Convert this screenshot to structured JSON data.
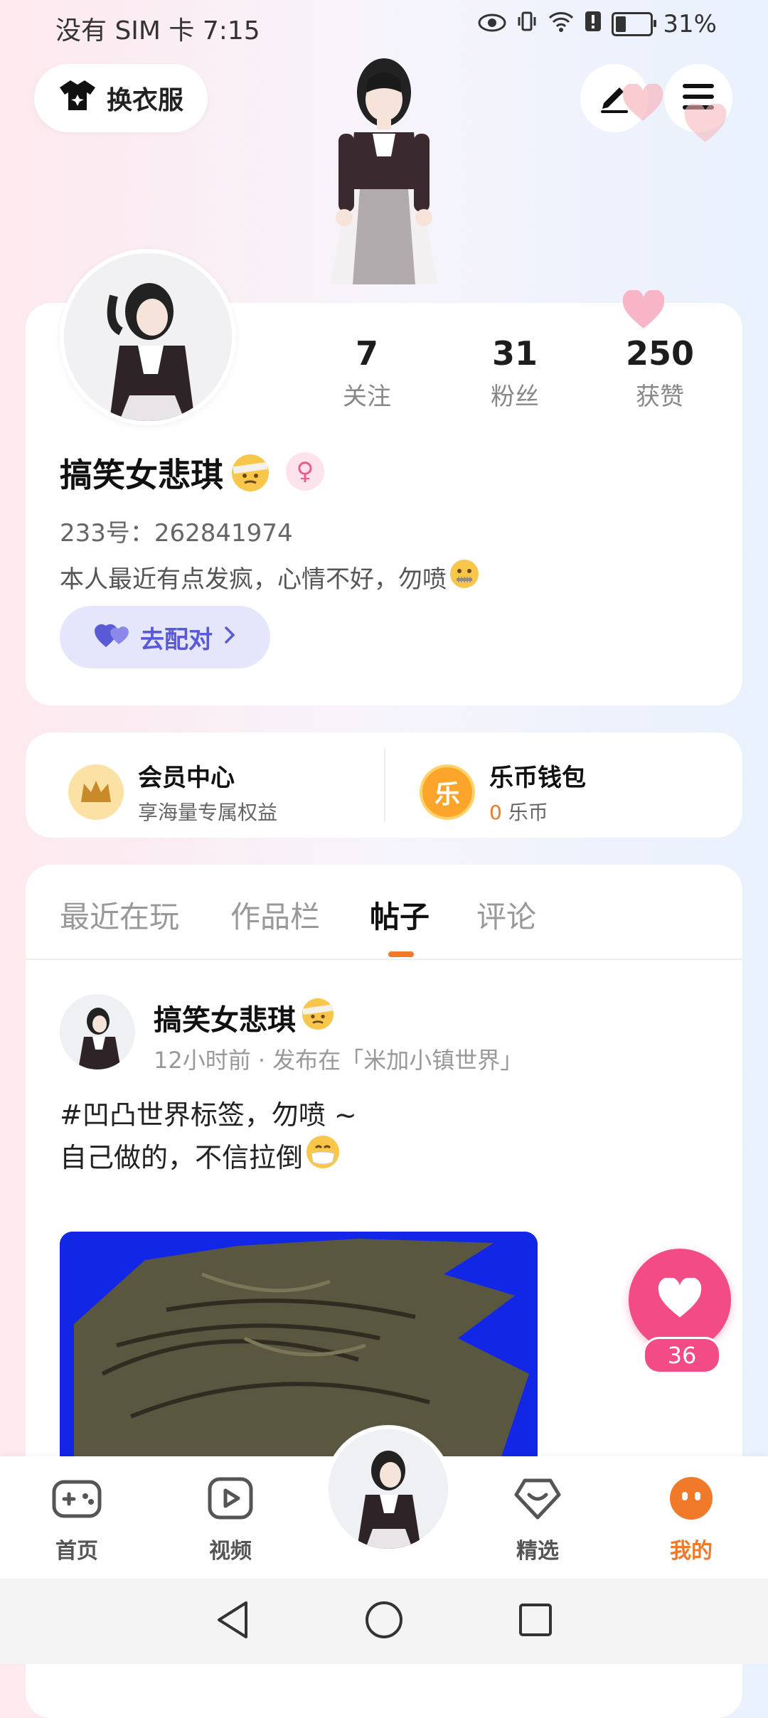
{
  "status_bar": {
    "carrier_time": "没有 SIM 卡 7:15",
    "battery": "31%",
    "battery_level": 0.31,
    "icons": [
      "eye-icon",
      "vibrate-icon",
      "wifi-icon",
      "alert-icon",
      "battery-icon"
    ]
  },
  "header": {
    "dress_label": "换衣服",
    "edit_icon": "edit-icon",
    "menu_icon": "menu-icon"
  },
  "profile": {
    "stats": [
      {
        "num": "7",
        "label": "关注"
      },
      {
        "num": "31",
        "label": "粉丝"
      },
      {
        "num": "250",
        "label": "获赞"
      }
    ],
    "name": "搞笑女悲琪",
    "gender_symbol": "♀",
    "uid": "233号：262841974",
    "bio": "本人最近有点发疯，心情不好，勿喷",
    "match_label": "去配对"
  },
  "member": {
    "vip_title": "会员中心",
    "vip_sub": "享海量专属权益",
    "wallet_title": "乐币钱包",
    "wallet_amount": "0",
    "wallet_unit": "乐币",
    "coin_char": "乐"
  },
  "tabs": [
    {
      "label": "最近在玩"
    },
    {
      "label": "作品栏"
    },
    {
      "label": "帖子"
    },
    {
      "label": "评论"
    }
  ],
  "active_tab": 2,
  "post": {
    "author": "搞笑女悲琪",
    "meta": "12小时前 · 发布在「米加小镇世界」",
    "line1": "#凹凸世界标签，勿喷 ~",
    "line2": "自己做的，不信拉倒"
  },
  "like": {
    "count": "36"
  },
  "bottom_nav": [
    {
      "label": "首页",
      "icon": "gamepad-icon"
    },
    {
      "label": "视频",
      "icon": "video-icon"
    },
    {
      "label": "精选",
      "icon": "heart-gem-icon"
    },
    {
      "label": "我的",
      "icon": "me-icon"
    }
  ],
  "colors": {
    "accent": "#f07a2a",
    "like": "#f24b85",
    "match": "#5a59d6"
  }
}
